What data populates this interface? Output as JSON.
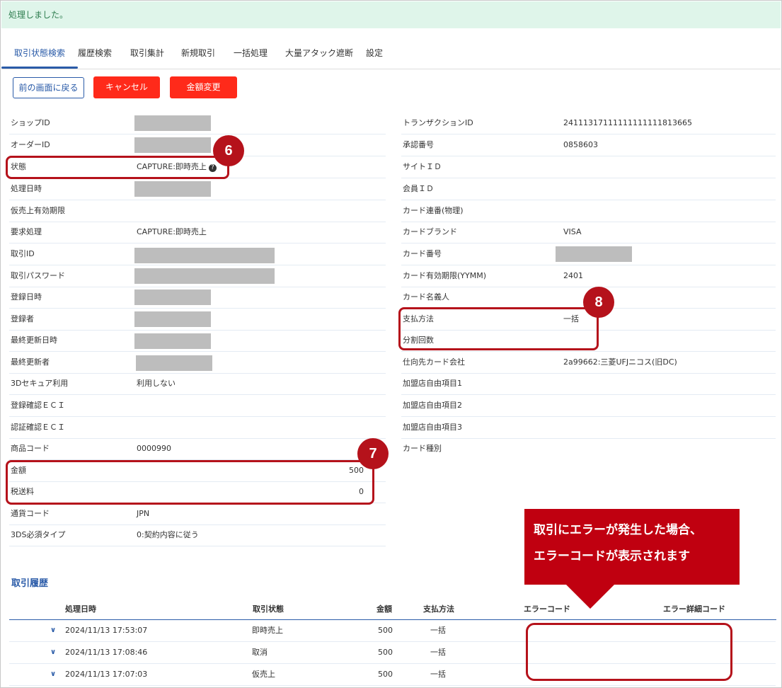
{
  "alert": {
    "message": "処理しました。"
  },
  "tabs": [
    {
      "label": "取引状態検索",
      "active": true
    },
    {
      "label": "履歴検索"
    },
    {
      "label": "取引集計"
    },
    {
      "label": "新規取引"
    },
    {
      "label": "一括処理"
    },
    {
      "label": "大量アタック遮断"
    },
    {
      "label": "設定"
    }
  ],
  "actions": {
    "back": "前の画面に戻る",
    "cancel": "キャンセル",
    "change_amount": "金額変更"
  },
  "left_fields": [
    {
      "label": "ショップID",
      "value": "",
      "masked": true
    },
    {
      "label": "オーダーID",
      "value": "",
      "masked": true
    },
    {
      "label": "状態",
      "value": "CAPTURE:即時売上"
    },
    {
      "label": "処理日時",
      "value": "",
      "masked": true
    },
    {
      "label": "仮売上有効期限",
      "value": ""
    },
    {
      "label": "要求処理",
      "value": "CAPTURE:即時売上"
    },
    {
      "label": "取引ID",
      "value": "",
      "masked": true
    },
    {
      "label": "取引パスワード",
      "value": "",
      "masked": true
    },
    {
      "label": "登録日時",
      "value": "",
      "masked": true
    },
    {
      "label": "登録者",
      "value": "",
      "masked": true
    },
    {
      "label": "最終更新日時",
      "value": "",
      "masked": true
    },
    {
      "label": "最終更新者",
      "value": "",
      "masked": true
    },
    {
      "label": "3Dセキュア利用",
      "value": "利用しない"
    },
    {
      "label": "登録確認ＥＣＩ",
      "value": ""
    },
    {
      "label": "認証確認ＥＣＩ",
      "value": ""
    },
    {
      "label": "商品コード",
      "value": "0000990"
    },
    {
      "label": "金額",
      "value": "500"
    },
    {
      "label": "税送料",
      "value": "0"
    },
    {
      "label": "通貨コード",
      "value": "JPN"
    },
    {
      "label": "3DS必須タイプ",
      "value": "0:契約内容に従う"
    }
  ],
  "right_fields": [
    {
      "label": "トランザクションID",
      "value": "24111317111111111111813665"
    },
    {
      "label": "承認番号",
      "value": "0858603"
    },
    {
      "label": "サイトＩＤ",
      "value": ""
    },
    {
      "label": "会員ＩＤ",
      "value": ""
    },
    {
      "label": "カード連番(物理)",
      "value": ""
    },
    {
      "label": "カードブランド",
      "value": "VISA"
    },
    {
      "label": "カード番号",
      "value": "",
      "masked": true
    },
    {
      "label": "カード有効期限(YYMM)",
      "value": "2401"
    },
    {
      "label": "カード名義人",
      "value": ""
    },
    {
      "label": "支払方法",
      "value": "一括"
    },
    {
      "label": "分割回数",
      "value": ""
    },
    {
      "label": "仕向先カード会社",
      "value": "2a99662:三菱UFJニコス(旧DC)"
    },
    {
      "label": "加盟店自由項目1",
      "value": ""
    },
    {
      "label": "加盟店自由項目2",
      "value": ""
    },
    {
      "label": "加盟店自由項目3",
      "value": ""
    },
    {
      "label": "カード種別",
      "value": ""
    }
  ],
  "badges": {
    "b6": "6",
    "b7": "7",
    "b8": "8"
  },
  "tooltip": {
    "line1": "取引にエラーが発生した場合、",
    "line2": "エラーコードが表示されます"
  },
  "history": {
    "title": "取引履歴",
    "headers": {
      "date": "処理日時",
      "status": "取引状態",
      "amount": "金額",
      "method": "支払方法",
      "error": "エラーコード",
      "error_detail": "エラー詳細コード"
    },
    "rows": [
      {
        "date": "2024/11/13 17:53:07",
        "status": "即時売上",
        "amount": "500",
        "method": "一括"
      },
      {
        "date": "2024/11/13 17:08:46",
        "status": "取消",
        "amount": "500",
        "method": "一括"
      },
      {
        "date": "2024/11/13 17:07:03",
        "status": "仮売上",
        "amount": "500",
        "method": "一括"
      }
    ]
  },
  "colors": {
    "accent": "#2a5ba8",
    "danger": "#ff2a1a",
    "callout": "#b5121b",
    "success_bg": "#dff5ea"
  }
}
